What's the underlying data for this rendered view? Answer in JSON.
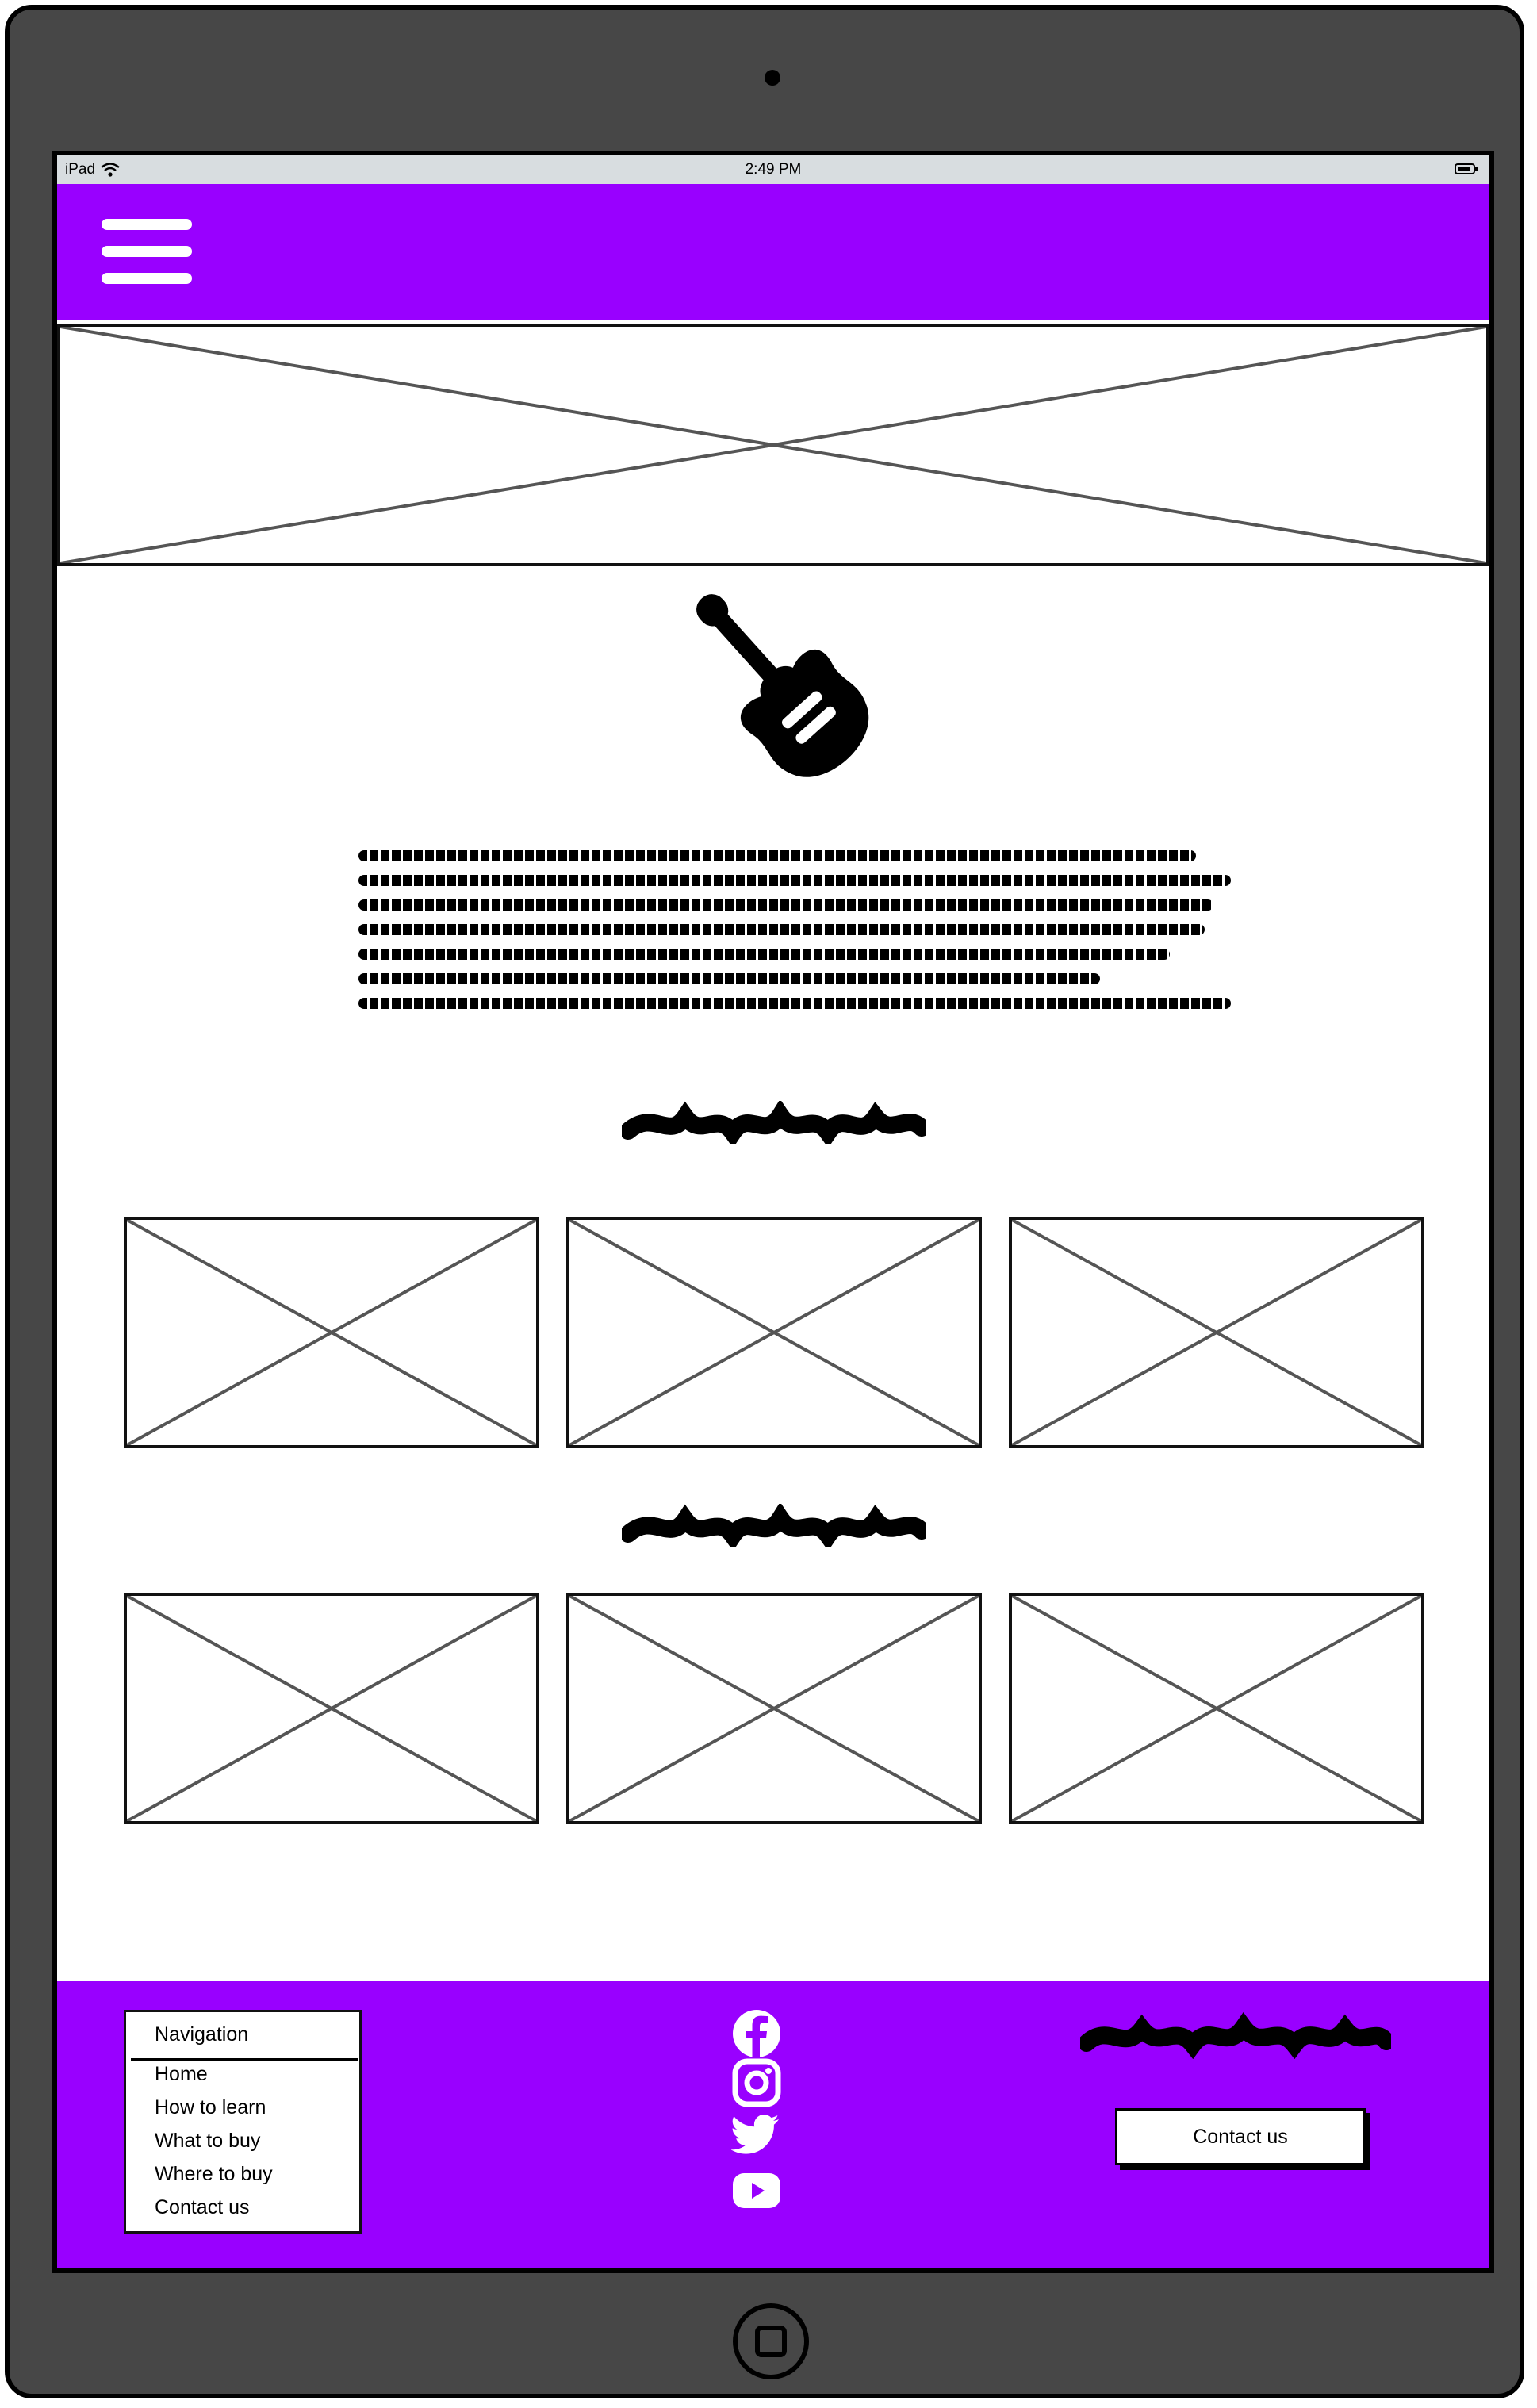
{
  "statusbar": {
    "device": "iPad",
    "time": "2:49 PM"
  },
  "icons": {
    "menu": "hamburger-menu-icon",
    "logo": "electric-guitar-icon",
    "facebook": "facebook-icon",
    "instagram": "instagram-icon",
    "twitter": "twitter-icon",
    "youtube": "youtube-icon"
  },
  "colors": {
    "brand": "#9900ff",
    "device": "#474747",
    "statusbar": "#d8dde0"
  },
  "footer": {
    "nav_title": "Navigation",
    "nav_items": [
      "Home",
      "How to learn",
      "What to buy",
      "Where to buy",
      "Contact us"
    ],
    "contact_button": "Contact us"
  }
}
